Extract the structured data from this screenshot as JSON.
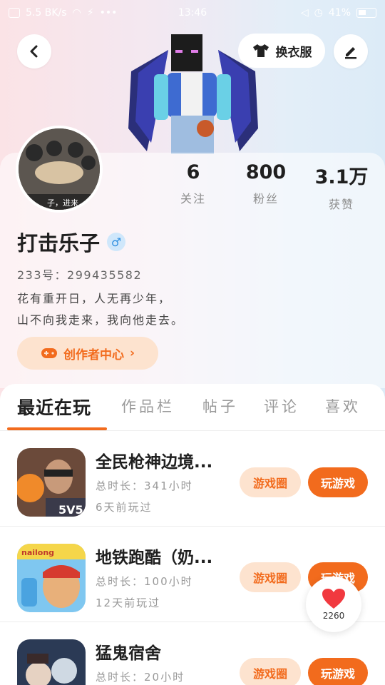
{
  "status_bar": {
    "left_text": "5.5 BK/s",
    "time": "13:46",
    "battery": "41%"
  },
  "header": {
    "dress_label": "换衣服"
  },
  "profile": {
    "stats": [
      {
        "value": "6",
        "label": "关注"
      },
      {
        "value": "800",
        "label": "粉丝"
      },
      {
        "value": "3.1万",
        "label": "获赞"
      }
    ],
    "username": "打击乐子",
    "gender_symbol": "♂",
    "uid": "233号：299435582",
    "bio_line1": "花有重开日，人无再少年，",
    "bio_line2": "山不向我走来，我向他走去。",
    "creator_label": "创作者中心",
    "avatar_caption": "子，进来"
  },
  "tabs": [
    "最近在玩",
    "作品栏",
    "帖子",
    "评论",
    "喜欢"
  ],
  "games": [
    {
      "title": "全民枪神边境...",
      "duration": "总时长：341小时",
      "last_played": "6天前玩过",
      "circle_label": "游戏圈",
      "play_label": "玩游戏",
      "icon_text": "5V5"
    },
    {
      "title": "地铁跑酷（奶...",
      "duration": "总时长：100小时",
      "last_played": "12天前玩过",
      "circle_label": "游戏圈",
      "play_label": "玩游戏",
      "icon_text": "nailong"
    },
    {
      "title": "猛鬼宿舍",
      "duration": "总时长：20小时",
      "last_played": "",
      "circle_label": "游戏圈",
      "play_label": "玩游戏",
      "icon_text": ""
    }
  ],
  "floating_like": {
    "count": "2260"
  },
  "colors": {
    "accent": "#f26b1d",
    "accent_light": "#fde3cf"
  }
}
